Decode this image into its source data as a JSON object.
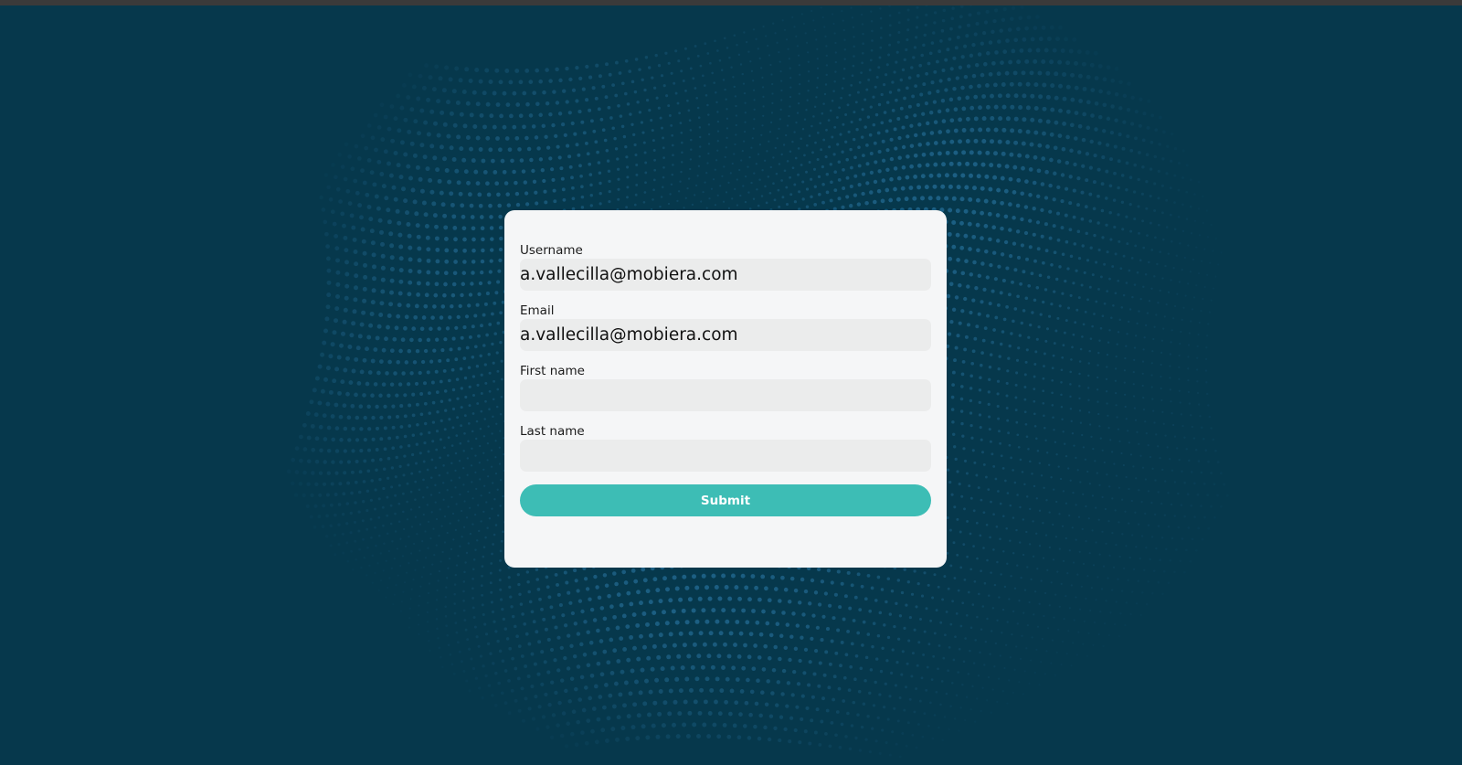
{
  "colors": {
    "background": "#06384c",
    "dots": "#2f7fb0",
    "card": "#f5f6f7",
    "input_bg": "#ebecec",
    "accent": "#3dbdb5"
  },
  "form": {
    "fields": [
      {
        "label": "Username",
        "value": "a.vallecilla@mobiera.com"
      },
      {
        "label": "Email",
        "value": "a.vallecilla@mobiera.com"
      },
      {
        "label": "First name",
        "value": ""
      },
      {
        "label": "Last name",
        "value": ""
      }
    ],
    "submit_label": "Submit"
  }
}
